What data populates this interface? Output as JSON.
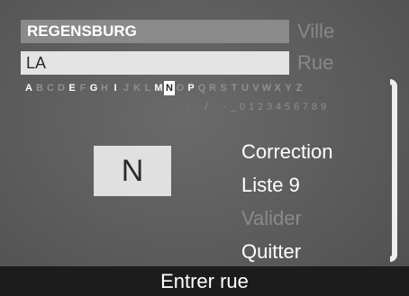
{
  "fields": {
    "city_value": "REGENSBURG",
    "city_label": "Ville",
    "street_value": "LA",
    "street_label": "Rue"
  },
  "keyboard": {
    "letters": [
      {
        "char": "A",
        "state": "enabled"
      },
      {
        "char": "B",
        "state": "disabled"
      },
      {
        "char": "C",
        "state": "disabled"
      },
      {
        "char": "D",
        "state": "disabled"
      },
      {
        "char": "E",
        "state": "enabled"
      },
      {
        "char": "F",
        "state": "disabled"
      },
      {
        "char": "G",
        "state": "enabled"
      },
      {
        "char": "H",
        "state": "disabled"
      },
      {
        "char": "I",
        "state": "enabled"
      },
      {
        "char": "J",
        "state": "disabled"
      },
      {
        "char": "K",
        "state": "disabled"
      },
      {
        "char": "L",
        "state": "disabled"
      },
      {
        "char": "M",
        "state": "enabled"
      },
      {
        "char": "N",
        "state": "selected"
      },
      {
        "char": "O",
        "state": "disabled"
      },
      {
        "char": "P",
        "state": "enabled"
      },
      {
        "char": "Q",
        "state": "disabled"
      },
      {
        "char": "R",
        "state": "disabled"
      },
      {
        "char": "S",
        "state": "disabled"
      },
      {
        "char": "T",
        "state": "disabled"
      },
      {
        "char": "U",
        "state": "disabled"
      },
      {
        "char": "V",
        "state": "disabled"
      },
      {
        "char": "W",
        "state": "disabled"
      },
      {
        "char": "X",
        "state": "disabled"
      },
      {
        "char": "Y",
        "state": "disabled"
      },
      {
        "char": "Z",
        "state": "disabled"
      }
    ],
    "symbols": [
      ".",
      ".",
      "/",
      " ",
      "-",
      "_",
      "0",
      "1",
      "2",
      "3",
      "4",
      "5",
      "6",
      "7",
      "8",
      "9"
    ]
  },
  "preview": {
    "char": "N"
  },
  "menu": {
    "correction": "Correction",
    "list": "Liste 9",
    "validate": "Valider",
    "quit": "Quitter"
  },
  "footer": {
    "title": "Entrer rue"
  },
  "colors": {
    "selected_key_bg": "#ffffff",
    "disabled": "#8f8f8f",
    "footer_bg": "#1c1c1c"
  }
}
